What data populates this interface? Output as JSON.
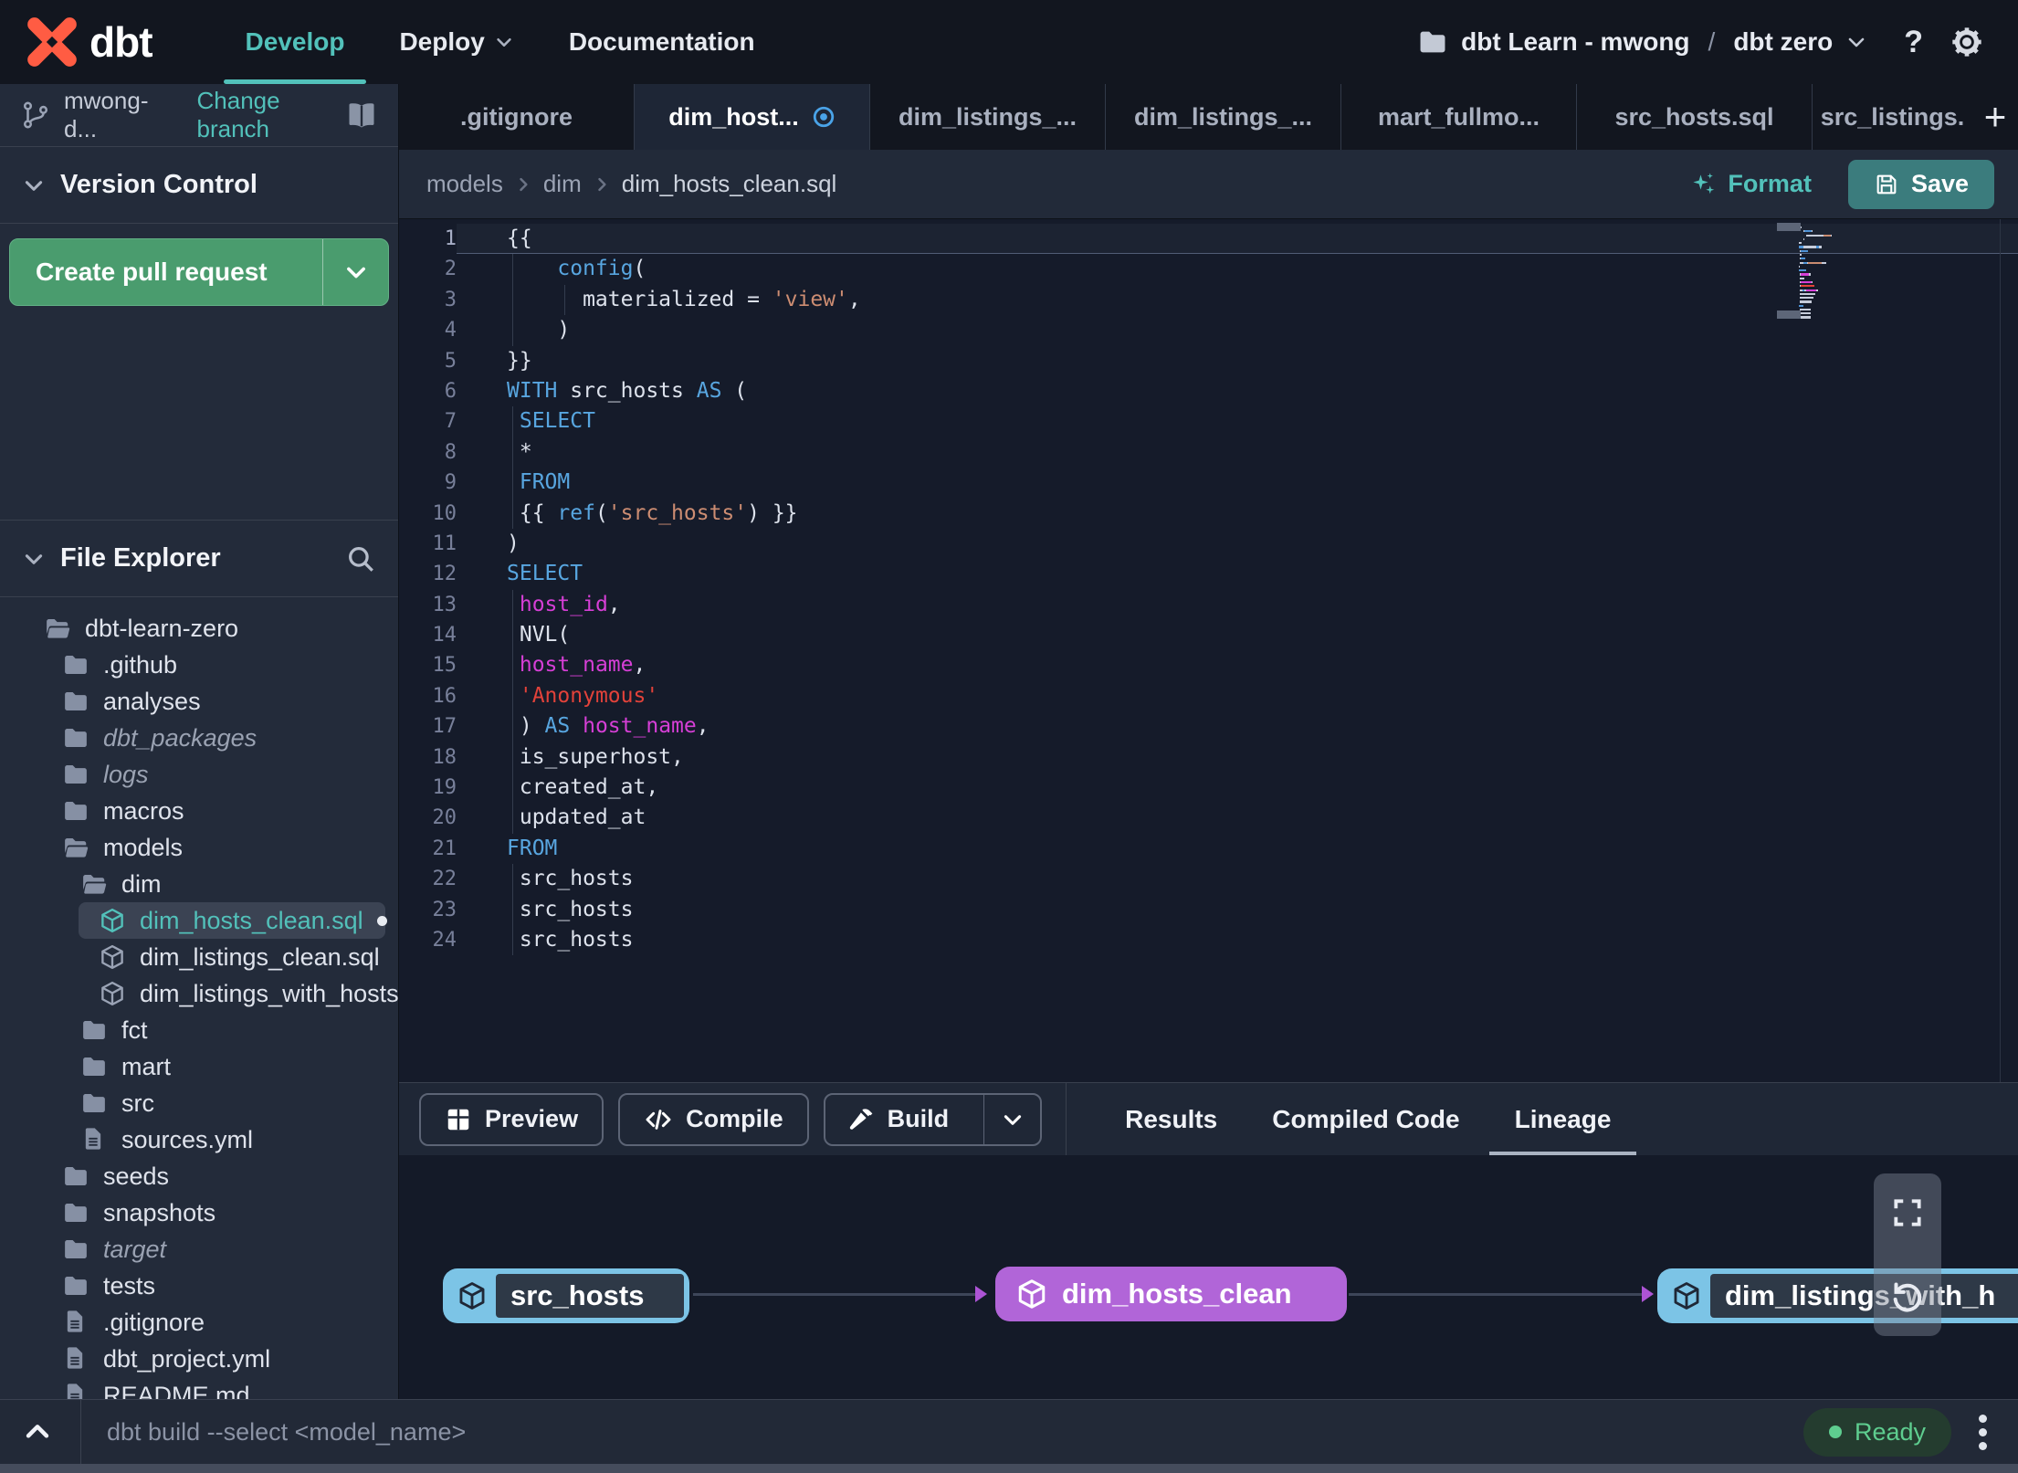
{
  "topbar": {
    "logo_text": "dbt",
    "nav": [
      {
        "label": "Develop",
        "active": true
      },
      {
        "label": "Deploy",
        "chevron": true
      },
      {
        "label": "Documentation"
      }
    ],
    "project": "dbt Learn - mwong",
    "separator": "/",
    "environment": "dbt zero",
    "help_label": "?"
  },
  "sidebar": {
    "branch": {
      "name": "mwong-d...",
      "change_label": "Change branch"
    },
    "version_control_title": "Version Control",
    "create_pr_label": "Create pull request",
    "file_explorer_title": "File Explorer",
    "tree": [
      {
        "name": "dbt-learn-zero",
        "type": "folder-open",
        "depth": 0
      },
      {
        "name": ".github",
        "type": "folder",
        "depth": 1
      },
      {
        "name": "analyses",
        "type": "folder",
        "depth": 1
      },
      {
        "name": "dbt_packages",
        "type": "folder",
        "depth": 1,
        "italic": true
      },
      {
        "name": "logs",
        "type": "folder",
        "depth": 1,
        "italic": true
      },
      {
        "name": "macros",
        "type": "folder",
        "depth": 1
      },
      {
        "name": "models",
        "type": "folder-open",
        "depth": 1
      },
      {
        "name": "dim",
        "type": "folder-open",
        "depth": 2
      },
      {
        "name": "dim_hosts_clean.sql",
        "type": "model",
        "depth": 3,
        "selected": true,
        "modified_dot": true
      },
      {
        "name": "dim_listings_clean.sql",
        "type": "model",
        "depth": 3
      },
      {
        "name": "dim_listings_with_hosts...",
        "type": "model",
        "depth": 3
      },
      {
        "name": "fct",
        "type": "folder",
        "depth": 2
      },
      {
        "name": "mart",
        "type": "folder",
        "depth": 2
      },
      {
        "name": "src",
        "type": "folder",
        "depth": 2
      },
      {
        "name": "sources.yml",
        "type": "file",
        "depth": 2
      },
      {
        "name": "seeds",
        "type": "folder",
        "depth": 1
      },
      {
        "name": "snapshots",
        "type": "folder",
        "depth": 1
      },
      {
        "name": "target",
        "type": "folder",
        "depth": 1,
        "italic": true
      },
      {
        "name": "tests",
        "type": "folder",
        "depth": 1
      },
      {
        "name": ".gitignore",
        "type": "file",
        "depth": 1
      },
      {
        "name": "dbt_project.yml",
        "type": "file",
        "depth": 1
      },
      {
        "name": "README.md",
        "type": "file",
        "depth": 1
      }
    ]
  },
  "editor_tabs": [
    {
      "label": ".gitignore"
    },
    {
      "label": "dim_host...",
      "active": true,
      "modified": true
    },
    {
      "label": "dim_listings_..."
    },
    {
      "label": "dim_listings_..."
    },
    {
      "label": "mart_fullmo..."
    },
    {
      "label": "src_hosts.sql"
    },
    {
      "label": "src_listings.",
      "last": true
    }
  ],
  "tab_plus_label": "+",
  "breadcrumb": {
    "items": [
      "models",
      "dim",
      "dim_hosts_clean.sql"
    ],
    "format_label": "Format",
    "save_label": "Save"
  },
  "editor": {
    "lines": [
      {
        "active": true,
        "segments": [
          [
            "p",
            "{{"
          ]
        ]
      },
      {
        "g": 1,
        "segments": [
          [
            "p",
            "    "
          ],
          [
            "k",
            "config"
          ],
          [
            "p",
            "("
          ]
        ]
      },
      {
        "g": 2,
        "segments": [
          [
            "p",
            "      materialized = "
          ],
          [
            "s",
            "'view'"
          ],
          [
            "p",
            ","
          ]
        ]
      },
      {
        "g": 1,
        "segments": [
          [
            "p",
            "    )"
          ]
        ]
      },
      {
        "segments": [
          [
            "p",
            "}}"
          ]
        ]
      },
      {
        "segments": [
          [
            "k",
            "WITH"
          ],
          [
            "p",
            " src_hosts "
          ],
          [
            "k",
            "AS"
          ],
          [
            "p",
            " ("
          ]
        ]
      },
      {
        "g": 1,
        "segments": [
          [
            "p",
            " "
          ],
          [
            "k",
            "SELECT"
          ]
        ]
      },
      {
        "g": 1,
        "segments": [
          [
            "p",
            " *"
          ]
        ]
      },
      {
        "g": 1,
        "segments": [
          [
            "p",
            " "
          ],
          [
            "k",
            "FROM"
          ]
        ]
      },
      {
        "g": 1,
        "segments": [
          [
            "p",
            " {{ "
          ],
          [
            "k",
            "ref"
          ],
          [
            "p",
            "("
          ],
          [
            "s",
            "'src_hosts'"
          ],
          [
            "p",
            ") }}"
          ]
        ]
      },
      {
        "segments": [
          [
            "p",
            ")"
          ]
        ]
      },
      {
        "segments": [
          [
            "k",
            "SELECT"
          ]
        ]
      },
      {
        "g": 1,
        "segments": [
          [
            "p",
            " "
          ],
          [
            "f",
            "host_id"
          ],
          [
            "p",
            ","
          ]
        ]
      },
      {
        "g": 1,
        "segments": [
          [
            "p",
            " NVL("
          ]
        ]
      },
      {
        "g": 1,
        "segments": [
          [
            "p",
            " "
          ],
          [
            "f",
            "host_name"
          ],
          [
            "p",
            ","
          ]
        ]
      },
      {
        "g": 1,
        "segments": [
          [
            "p",
            " "
          ],
          [
            "r",
            "'Anonymous'"
          ]
        ]
      },
      {
        "g": 1,
        "segments": [
          [
            "p",
            " ) "
          ],
          [
            "k",
            "AS"
          ],
          [
            "p",
            " "
          ],
          [
            "f",
            "host_name"
          ],
          [
            "p",
            ","
          ]
        ]
      },
      {
        "g": 1,
        "segments": [
          [
            "p",
            " is_superhost,"
          ]
        ]
      },
      {
        "g": 1,
        "segments": [
          [
            "p",
            " created_at,"
          ]
        ]
      },
      {
        "g": 1,
        "segments": [
          [
            "p",
            " updated_at"
          ]
        ]
      },
      {
        "segments": [
          [
            "k",
            "FROM"
          ]
        ]
      },
      {
        "g": 1,
        "segments": [
          [
            "p",
            " src_hosts"
          ]
        ]
      },
      {
        "g": 1,
        "segments": [
          [
            "p",
            " src_hosts"
          ]
        ]
      },
      {
        "g": 1,
        "segments": [
          [
            "p",
            " src_hosts"
          ]
        ]
      }
    ]
  },
  "bottom_panel": {
    "buttons": [
      {
        "label": "Preview",
        "icon": "grid-icon"
      },
      {
        "label": "Compile",
        "icon": "code-icon"
      },
      {
        "label": "Build",
        "icon": "hammer-icon",
        "split": true
      }
    ],
    "tabs": [
      {
        "label": "Results"
      },
      {
        "label": "Compiled Code"
      },
      {
        "label": "Lineage",
        "active": true
      }
    ]
  },
  "lineage": {
    "nodes": [
      {
        "label": "src_hosts",
        "kind": "source"
      },
      {
        "label": "dim_hosts_clean",
        "kind": "model"
      },
      {
        "label": "dim_listings_with_h",
        "kind": "source"
      }
    ]
  },
  "command_bar": {
    "placeholder": "dbt build --select <model_name>",
    "status": "Ready"
  },
  "colors": {
    "accent_teal": "#52c1ba",
    "pr_green": "#4a9c6e",
    "save_teal": "#3b7c7d",
    "keyword_blue": "#58a6e0",
    "field_magenta": "#d63fd6",
    "string_salmon": "#cd8d72",
    "string_red": "#e2423a",
    "node_blue": "#7cc4e6",
    "node_purple": "#b165d8",
    "ready_green": "#5ecd8f",
    "modified_blue": "#4aa3e8",
    "logo_orange": "#ff5c43"
  }
}
